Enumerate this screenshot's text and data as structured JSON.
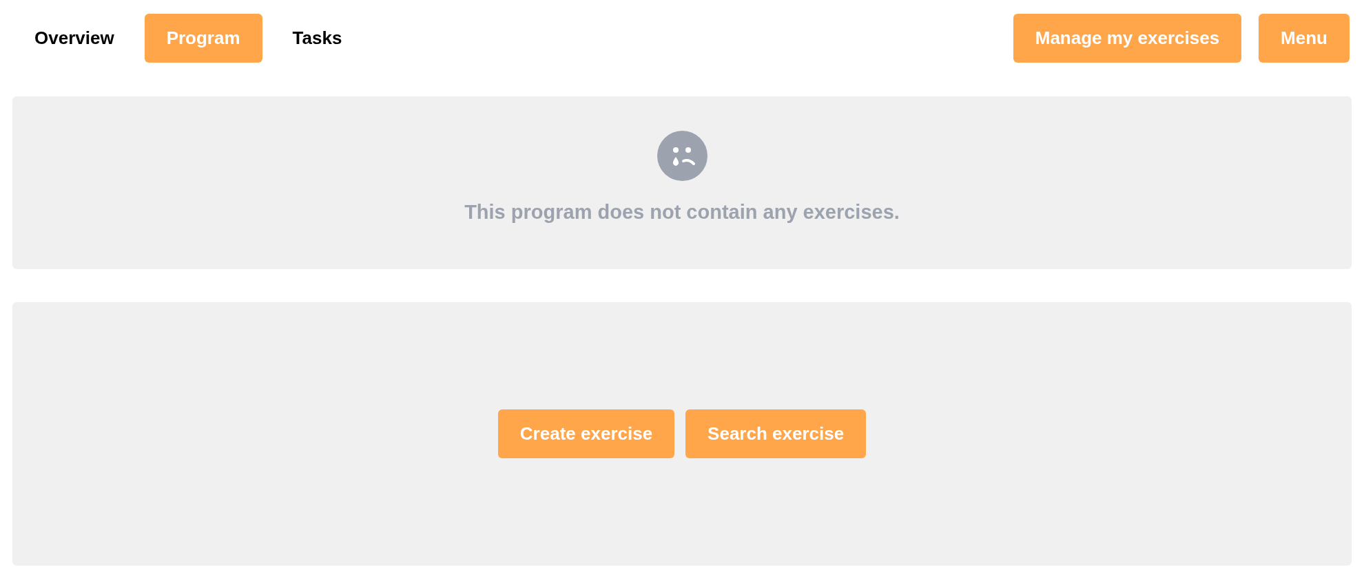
{
  "tabs": [
    {
      "label": "Overview",
      "selected": false
    },
    {
      "label": "Program",
      "selected": true
    },
    {
      "label": "Tasks",
      "selected": false
    }
  ],
  "header_buttons": [
    "Manage my exercises",
    "Menu"
  ],
  "empty_state": {
    "message": "This program does not contain any exercises."
  },
  "actions": [
    "Create exercise",
    "Search exercise"
  ]
}
